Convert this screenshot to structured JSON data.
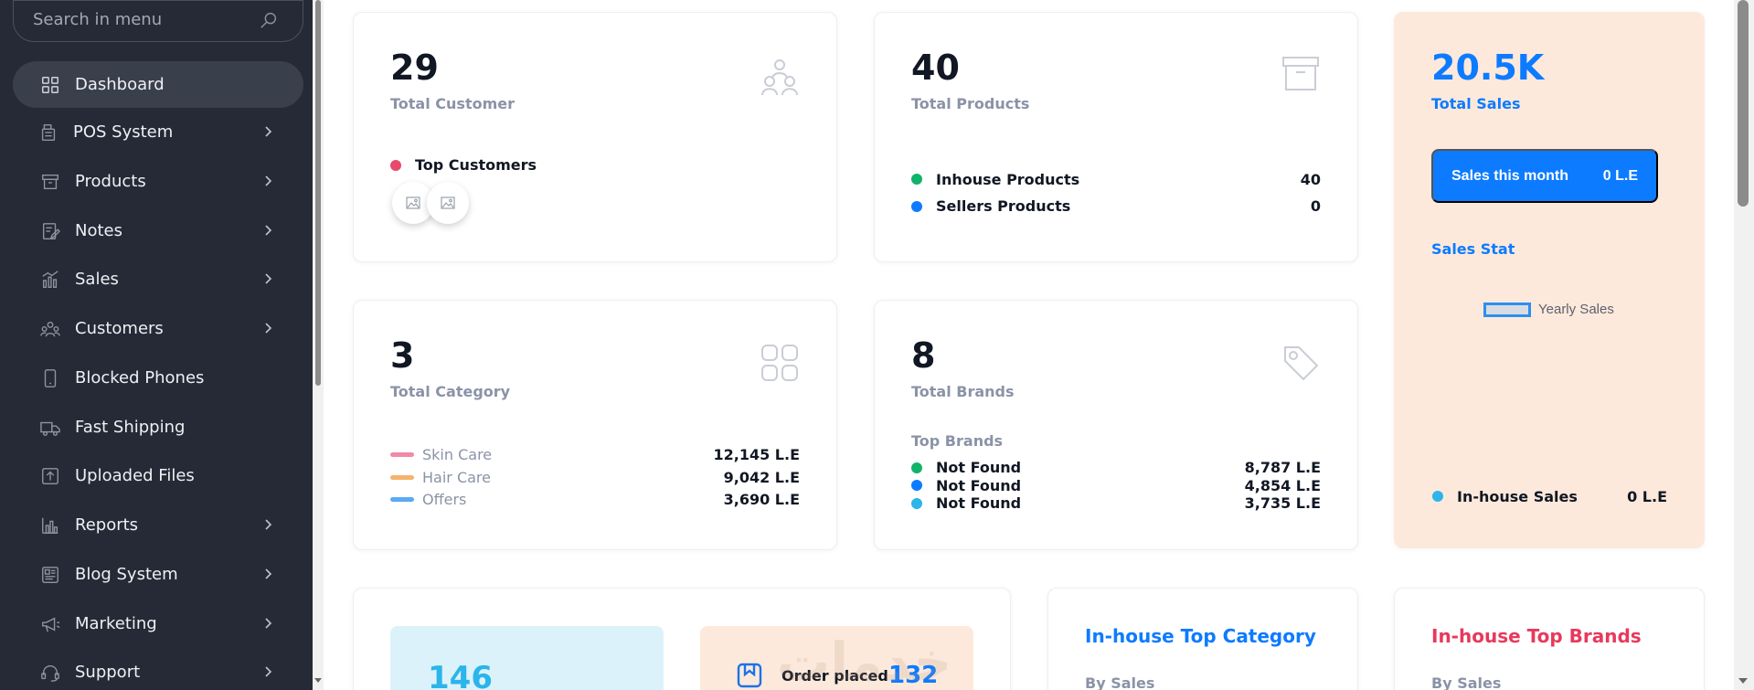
{
  "sidebar": {
    "search_placeholder": "Search in menu",
    "items": [
      {
        "label": "Dashboard",
        "icon": "grid-icon",
        "active": true,
        "chevron": false
      },
      {
        "label": "POS System",
        "icon": "pos-icon",
        "chevron": true
      },
      {
        "label": "Products",
        "icon": "box-icon",
        "chevron": true
      },
      {
        "label": "Notes",
        "icon": "note-icon",
        "chevron": true
      },
      {
        "label": "Sales",
        "icon": "bar-chart-icon",
        "chevron": true
      },
      {
        "label": "Customers",
        "icon": "users-icon",
        "chevron": true
      },
      {
        "label": "Blocked Phones",
        "icon": "phone-icon",
        "chevron": false
      },
      {
        "label": "Fast Shipping",
        "icon": "truck-icon",
        "chevron": false
      },
      {
        "label": "Uploaded Files",
        "icon": "upload-icon",
        "chevron": false
      },
      {
        "label": "Reports",
        "icon": "report-icon",
        "chevron": true
      },
      {
        "label": "Blog System",
        "icon": "blog-icon",
        "chevron": true
      },
      {
        "label": "Marketing",
        "icon": "megaphone-icon",
        "chevron": true
      },
      {
        "label": "Support",
        "icon": "headset-icon",
        "chevron": true
      }
    ]
  },
  "customers": {
    "value": "29",
    "label": "Total Customer",
    "top_label": "Top Customers"
  },
  "products": {
    "value": "40",
    "label": "Total Products",
    "rows": [
      {
        "label": "Inhouse Products",
        "value": "40"
      },
      {
        "label": "Sellers Products",
        "value": "0"
      }
    ]
  },
  "sales": {
    "value": "20.5K",
    "label": "Total Sales",
    "month_label": "Sales this month",
    "month_value": "0 L.E",
    "stat_label": "Sales Stat",
    "legend": "Yearly Sales",
    "inhouse_label": "In-house Sales",
    "inhouse_value": "0 L.E"
  },
  "category": {
    "value": "3",
    "label": "Total Category",
    "rows": [
      {
        "label": "Skin Care",
        "value": "12,145 L.E"
      },
      {
        "label": "Hair Care",
        "value": "9,042 L.E"
      },
      {
        "label": "Offers",
        "value": "3,690 L.E"
      }
    ]
  },
  "brands": {
    "value": "8",
    "label": "Total Brands",
    "top_label": "Top Brands",
    "rows": [
      {
        "label": "Not Found",
        "value": "8,787 L.E"
      },
      {
        "label": "Not Found",
        "value": "4,854 L.E"
      },
      {
        "label": "Not Found",
        "value": "3,735 L.E"
      }
    ]
  },
  "bottom": {
    "stat_value": "146",
    "order_label": "Order placed",
    "order_value": "132",
    "top_category_title": "In-house Top Category",
    "top_category_sub": "By Sales",
    "top_brands_title": "In-house Top Brands",
    "top_brands_sub": "By Sales",
    "watermark": "خدمات"
  },
  "colors": {
    "accent_blue": "#0d7bff",
    "dot_green": "#10b368",
    "dot_red": "#e84a6a",
    "dot_cyan": "#2bb5ea",
    "dash_pink": "#f28aa6",
    "dash_orange": "#f4b36b",
    "dash_blue": "#5aa9f5",
    "brand_red": "#e8395b"
  }
}
